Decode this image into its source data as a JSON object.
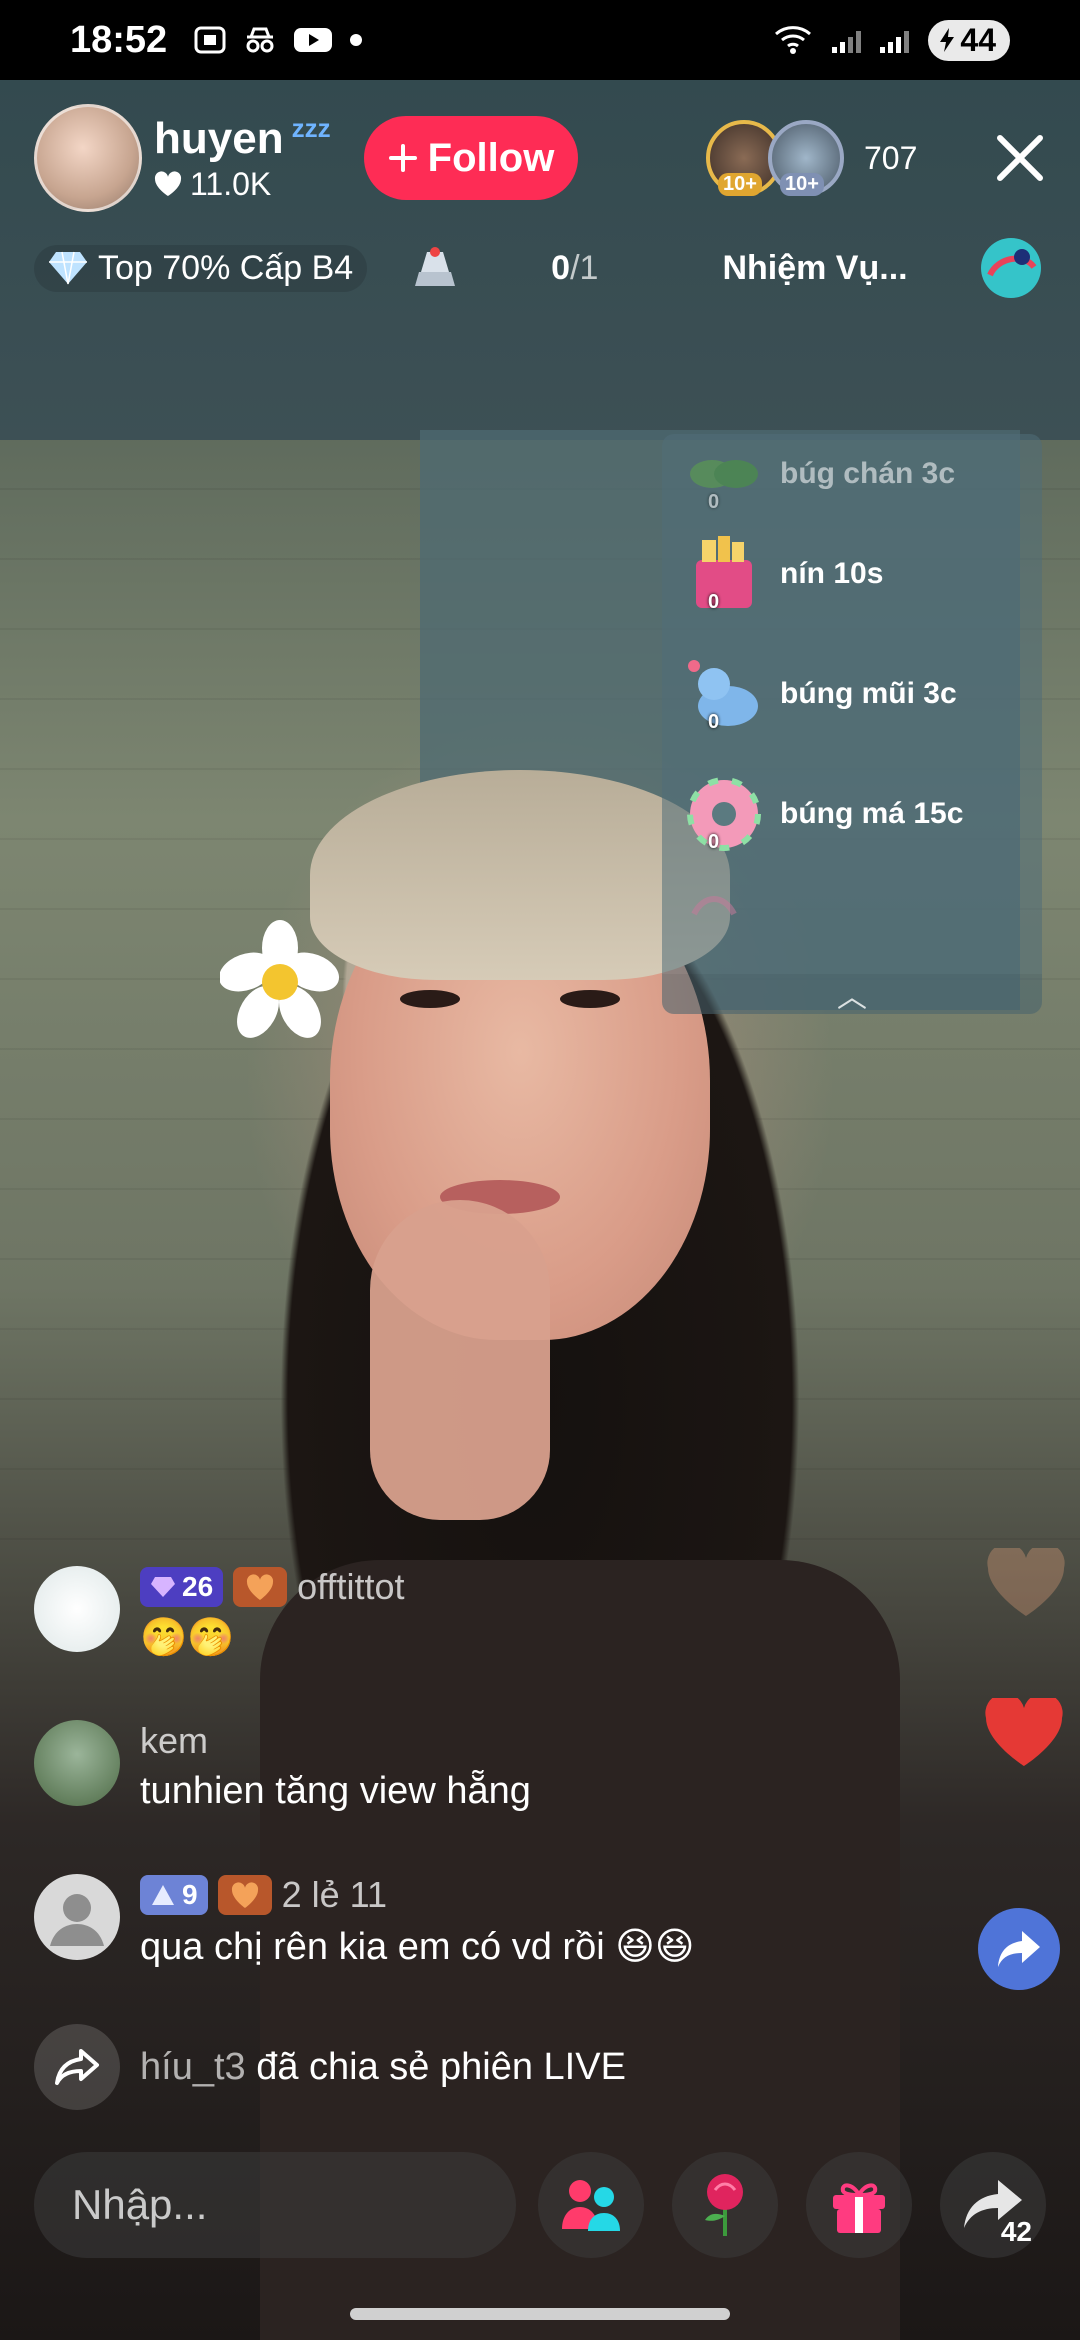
{
  "status_bar": {
    "time": "18:52",
    "battery": "44"
  },
  "host": {
    "name": "huyen",
    "sleep_indicator": "zzz",
    "likes": "11.0K",
    "follow_label": "Follow"
  },
  "viewers": {
    "badge_1": "10+",
    "badge_2": "10+",
    "count": "707"
  },
  "info_row": {
    "rank": "Top 70% Cấp B4",
    "progress_done": "0",
    "progress_total": "/1",
    "task_label": "Nhiệm Vụ..."
  },
  "goals": {
    "items": [
      {
        "label": "búg chán 3c",
        "count": "0",
        "icon": "clover-icon"
      },
      {
        "label": "nín 10s",
        "count": "0",
        "icon": "gift-box-icon"
      },
      {
        "label": "búng mũi 3c",
        "count": "0",
        "icon": "seal-icon"
      },
      {
        "label": "búng má 15c",
        "count": "0",
        "icon": "donut-icon"
      }
    ]
  },
  "comments": [
    {
      "user": "offtittot",
      "level": "26",
      "text": "🤭🤭"
    },
    {
      "user": "kem",
      "text": "tunhien tăng view hẵng"
    },
    {
      "user": "2 lẻ 11",
      "level": "9",
      "text": "qua chị rên kia em có vd rồi 😆😆"
    }
  ],
  "share_event": {
    "user": "híu_t3",
    "text": " đã chia sẻ phiên LIVE"
  },
  "bottom_bar": {
    "input_placeholder": "Nhập...",
    "share_count": "42"
  },
  "colors": {
    "follow": "#fe2c55",
    "like_heart": "#e53935",
    "share_fab": "#4f74d8"
  }
}
